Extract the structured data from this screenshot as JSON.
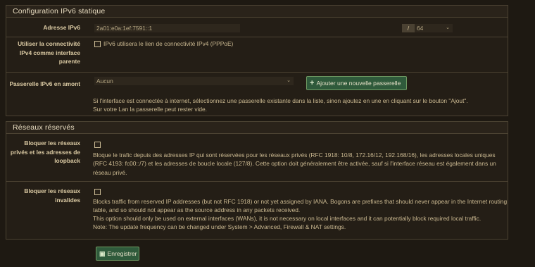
{
  "ipv6_static": {
    "title": "Configuration IPv6 statique",
    "address_label": "Adresse IPv6",
    "address_value": "2a01:e0a:1ef:7591::1",
    "prefix_separator": "/",
    "prefix_value": "64",
    "use_ipv4_label": "Utiliser la connectivité IPv4 comme interface parente",
    "use_ipv4_text": "IPv6 utilisera le lien de connectivité IPv4 (PPPoE)",
    "gateway_label": "Passerelle IPv6 en amont",
    "gateway_value": "Aucun",
    "add_gateway_button": "Ajouter une nouvelle passerelle",
    "gateway_help_1": "Si l'interface est connectée à internet, sélectionnez une passerelle existante dans la liste, sinon ajoutez en une en cliquant sur le bouton \"Ajout\".",
    "gateway_help_2": "Sur votre Lan la passerelle peut rester vide."
  },
  "reserved": {
    "title": "Réseaux réservés",
    "private_label": "Bloquer les réseaux privés et les adresses de loopback",
    "private_help": "Bloque le trafic depuis des adresses IP qui sont réservées pour les réseaux privés (RFC 1918: 10/8, 172.16/12, 192.168/16), les adresses locales uniques (RFC 4193: fc00::/7) et les adresses de boucle locale (127/8). Cette option doit généralement être activée, sauf si l'interface réseau est également dans un réseau privé.",
    "bogons_label": "Bloquer les réseaux invalides",
    "bogons_help_1": "Blocks traffic from reserved IP addresses (but not RFC 1918) or not yet assigned by IANA. Bogons are prefixes that should never appear in the Internet routing table, and so should not appear as the source address in any packets received.",
    "bogons_help_2": "This option should only be used on external interfaces (WANs), it is not necessary on local interfaces and it can potentially block required local traffic.",
    "bogons_help_3": "Note: The update frequency can be changed under System > Advanced, Firewall & NAT settings."
  },
  "save_button": "Enregistrer",
  "icons": {
    "add": "plus-icon",
    "save": "save-icon",
    "dropdown": "chevron-down-icon"
  }
}
